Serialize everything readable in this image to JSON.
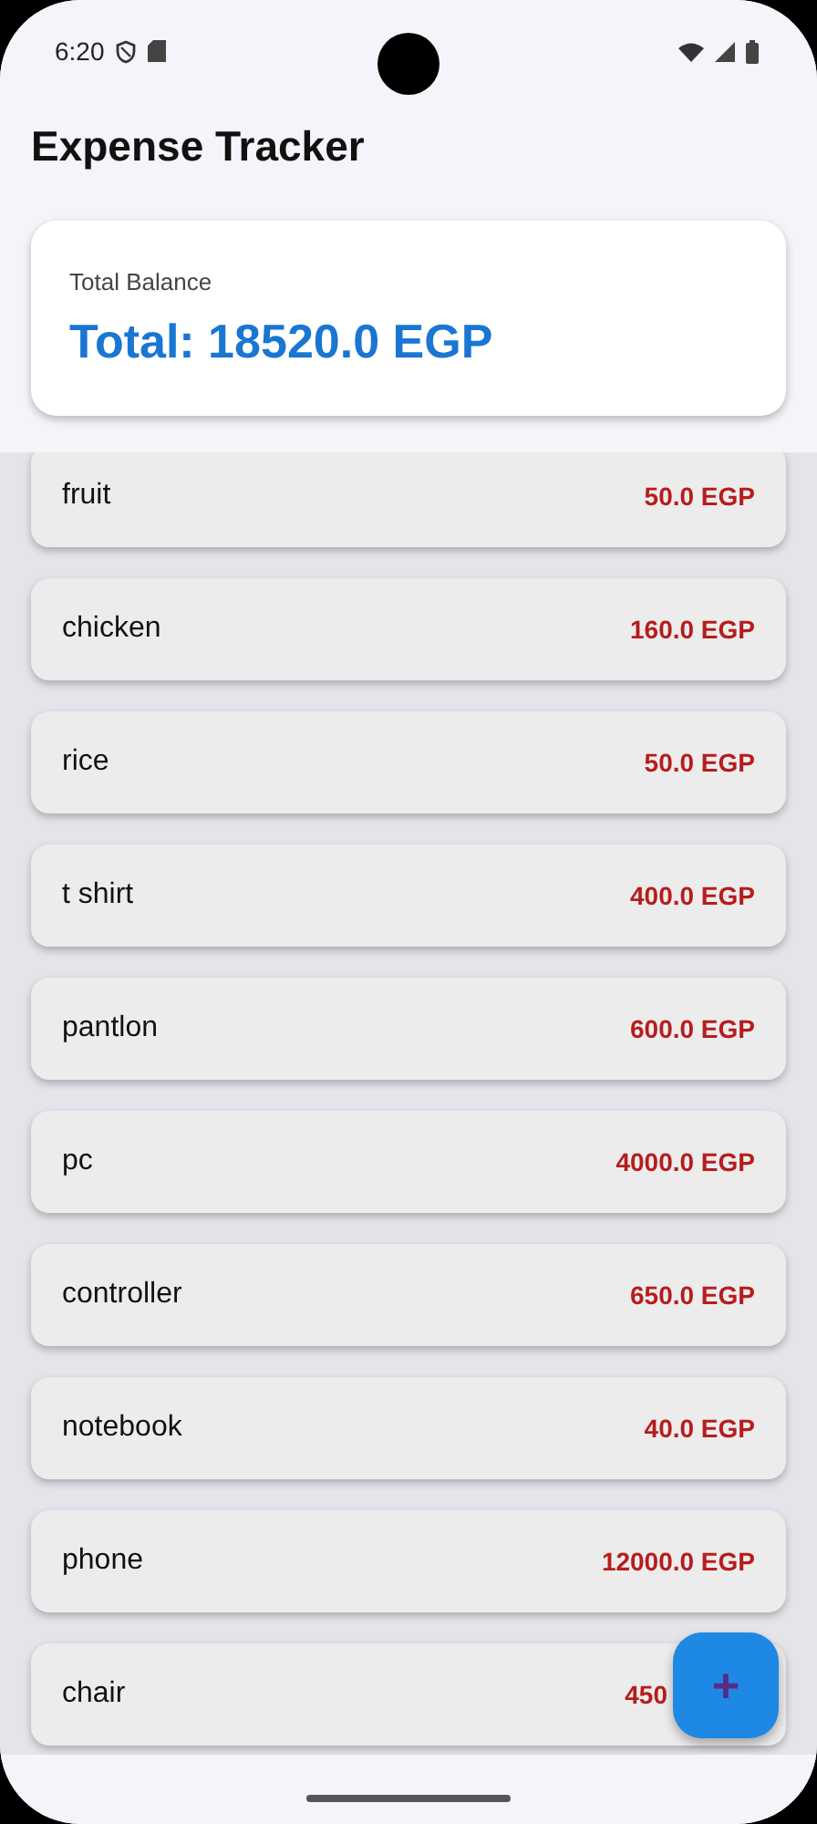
{
  "status_bar": {
    "time": "6:20"
  },
  "app_bar": {
    "title": "Expense Tracker"
  },
  "balance_card": {
    "label": "Total Balance",
    "total": "Total: 18520.0 EGP"
  },
  "expenses": [
    {
      "name": "fruit",
      "amount": "50.0 EGP"
    },
    {
      "name": "chicken",
      "amount": "160.0 EGP"
    },
    {
      "name": "rice",
      "amount": "50.0 EGP"
    },
    {
      "name": "t shirt",
      "amount": "400.0 EGP"
    },
    {
      "name": "pantlon",
      "amount": "600.0 EGP"
    },
    {
      "name": "pc",
      "amount": "4000.0 EGP"
    },
    {
      "name": "controller",
      "amount": "650.0 EGP"
    },
    {
      "name": "notebook",
      "amount": "40.0 EGP"
    },
    {
      "name": "phone",
      "amount": "12000.0 EGP"
    },
    {
      "name": "chair",
      "amount": "450"
    }
  ],
  "fab": {
    "label": "+"
  }
}
